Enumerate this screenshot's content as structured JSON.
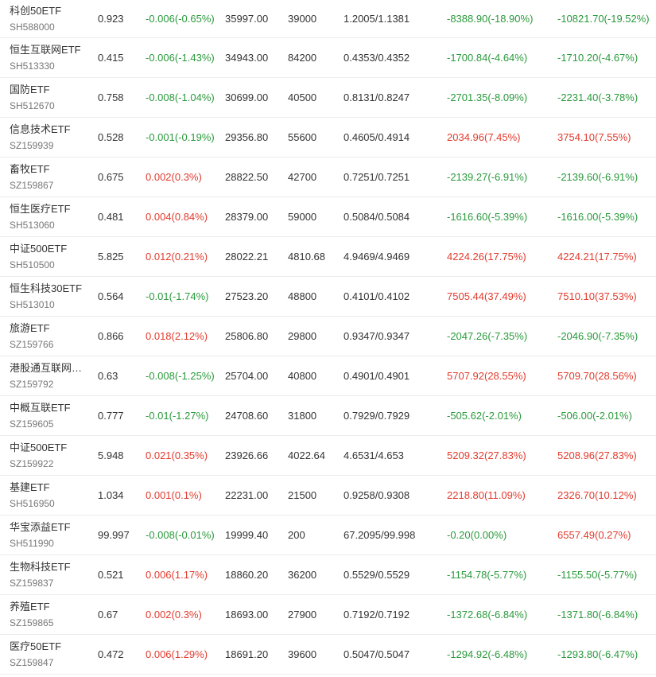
{
  "rows": [
    {
      "name": "科创50ETF",
      "code": "SH588000",
      "price": "0.923",
      "change": "-0.006(-0.65%)",
      "change_dir": "down",
      "amount": "35997.00",
      "volume": "39000",
      "nav": "1.2005/1.1381",
      "pnl1": "-8388.90(-18.90%)",
      "pnl1_dir": "down",
      "pnl2": "-10821.70(-19.52%)",
      "pnl2_dir": "down"
    },
    {
      "name": "恒生互联网ETF",
      "code": "SH513330",
      "price": "0.415",
      "change": "-0.006(-1.43%)",
      "change_dir": "down",
      "amount": "34943.00",
      "volume": "84200",
      "nav": "0.4353/0.4352",
      "pnl1": "-1700.84(-4.64%)",
      "pnl1_dir": "down",
      "pnl2": "-1710.20(-4.67%)",
      "pnl2_dir": "down"
    },
    {
      "name": "国防ETF",
      "code": "SH512670",
      "price": "0.758",
      "change": "-0.008(-1.04%)",
      "change_dir": "down",
      "amount": "30699.00",
      "volume": "40500",
      "nav": "0.8131/0.8247",
      "pnl1": "-2701.35(-8.09%)",
      "pnl1_dir": "down",
      "pnl2": "-2231.40(-3.78%)",
      "pnl2_dir": "down"
    },
    {
      "name": "信息技术ETF",
      "code": "SZ159939",
      "price": "0.528",
      "change": "-0.001(-0.19%)",
      "change_dir": "down",
      "amount": "29356.80",
      "volume": "55600",
      "nav": "0.4605/0.4914",
      "pnl1": "2034.96(7.45%)",
      "pnl1_dir": "up",
      "pnl2": "3754.10(7.55%)",
      "pnl2_dir": "up"
    },
    {
      "name": "畜牧ETF",
      "code": "SZ159867",
      "price": "0.675",
      "change": "0.002(0.3%)",
      "change_dir": "up",
      "amount": "28822.50",
      "volume": "42700",
      "nav": "0.7251/0.7251",
      "pnl1": "-2139.27(-6.91%)",
      "pnl1_dir": "down",
      "pnl2": "-2139.60(-6.91%)",
      "pnl2_dir": "down"
    },
    {
      "name": "恒生医疗ETF",
      "code": "SH513060",
      "price": "0.481",
      "change": "0.004(0.84%)",
      "change_dir": "up",
      "amount": "28379.00",
      "volume": "59000",
      "nav": "0.5084/0.5084",
      "pnl1": "-1616.60(-5.39%)",
      "pnl1_dir": "down",
      "pnl2": "-1616.00(-5.39%)",
      "pnl2_dir": "down"
    },
    {
      "name": "中证500ETF",
      "code": "SH510500",
      "price": "5.825",
      "change": "0.012(0.21%)",
      "change_dir": "up",
      "amount": "28022.21",
      "volume": "4810.68",
      "nav": "4.9469/4.9469",
      "pnl1": "4224.26(17.75%)",
      "pnl1_dir": "up",
      "pnl2": "4224.21(17.75%)",
      "pnl2_dir": "up"
    },
    {
      "name": "恒生科技30ETF",
      "code": "SH513010",
      "price": "0.564",
      "change": "-0.01(-1.74%)",
      "change_dir": "down",
      "amount": "27523.20",
      "volume": "48800",
      "nav": "0.4101/0.4102",
      "pnl1": "7505.44(37.49%)",
      "pnl1_dir": "up",
      "pnl2": "7510.10(37.53%)",
      "pnl2_dir": "up"
    },
    {
      "name": "旅游ETF",
      "code": "SZ159766",
      "price": "0.866",
      "change": "0.018(2.12%)",
      "change_dir": "up",
      "amount": "25806.80",
      "volume": "29800",
      "nav": "0.9347/0.9347",
      "pnl1": "-2047.26(-7.35%)",
      "pnl1_dir": "down",
      "pnl2": "-2046.90(-7.35%)",
      "pnl2_dir": "down"
    },
    {
      "name": "港股通互联网…",
      "code": "SZ159792",
      "price": "0.63",
      "change": "-0.008(-1.25%)",
      "change_dir": "down",
      "amount": "25704.00",
      "volume": "40800",
      "nav": "0.4901/0.4901",
      "pnl1": "5707.92(28.55%)",
      "pnl1_dir": "up",
      "pnl2": "5709.70(28.56%)",
      "pnl2_dir": "up"
    },
    {
      "name": "中概互联ETF",
      "code": "SZ159605",
      "price": "0.777",
      "change": "-0.01(-1.27%)",
      "change_dir": "down",
      "amount": "24708.60",
      "volume": "31800",
      "nav": "0.7929/0.7929",
      "pnl1": "-505.62(-2.01%)",
      "pnl1_dir": "down",
      "pnl2": "-506.00(-2.01%)",
      "pnl2_dir": "down"
    },
    {
      "name": "中证500ETF",
      "code": "SZ159922",
      "price": "5.948",
      "change": "0.021(0.35%)",
      "change_dir": "up",
      "amount": "23926.66",
      "volume": "4022.64",
      "nav": "4.6531/4.653",
      "pnl1": "5209.32(27.83%)",
      "pnl1_dir": "up",
      "pnl2": "5208.96(27.83%)",
      "pnl2_dir": "up"
    },
    {
      "name": "基建ETF",
      "code": "SH516950",
      "price": "1.034",
      "change": "0.001(0.1%)",
      "change_dir": "up",
      "amount": "22231.00",
      "volume": "21500",
      "nav": "0.9258/0.9308",
      "pnl1": "2218.80(11.09%)",
      "pnl1_dir": "up",
      "pnl2": "2326.70(10.12%)",
      "pnl2_dir": "up"
    },
    {
      "name": "华宝添益ETF",
      "code": "SH511990",
      "price": "99.997",
      "change": "-0.008(-0.01%)",
      "change_dir": "down",
      "amount": "19999.40",
      "volume": "200",
      "nav": "67.2095/99.998",
      "pnl1": "-0.20(0.00%)",
      "pnl1_dir": "down",
      "pnl2": "6557.49(0.27%)",
      "pnl2_dir": "up"
    },
    {
      "name": "生物科技ETF",
      "code": "SZ159837",
      "price": "0.521",
      "change": "0.006(1.17%)",
      "change_dir": "up",
      "amount": "18860.20",
      "volume": "36200",
      "nav": "0.5529/0.5529",
      "pnl1": "-1154.78(-5.77%)",
      "pnl1_dir": "down",
      "pnl2": "-1155.50(-5.77%)",
      "pnl2_dir": "down"
    },
    {
      "name": "养殖ETF",
      "code": "SZ159865",
      "price": "0.67",
      "change": "0.002(0.3%)",
      "change_dir": "up",
      "amount": "18693.00",
      "volume": "27900",
      "nav": "0.7192/0.7192",
      "pnl1": "-1372.68(-6.84%)",
      "pnl1_dir": "down",
      "pnl2": "-1371.80(-6.84%)",
      "pnl2_dir": "down"
    },
    {
      "name": "医疗50ETF",
      "code": "SZ159847",
      "price": "0.472",
      "change": "0.006(1.29%)",
      "change_dir": "up",
      "amount": "18691.20",
      "volume": "39600",
      "nav": "0.5047/0.5047",
      "pnl1": "-1294.92(-6.48%)",
      "pnl1_dir": "down",
      "pnl2": "-1293.80(-6.47%)",
      "pnl2_dir": "down"
    }
  ],
  "colors": {
    "up": "#e23b2e",
    "down": "#2a9a3c",
    "text": "#333333",
    "code": "#777777",
    "divider": "#ececec"
  }
}
